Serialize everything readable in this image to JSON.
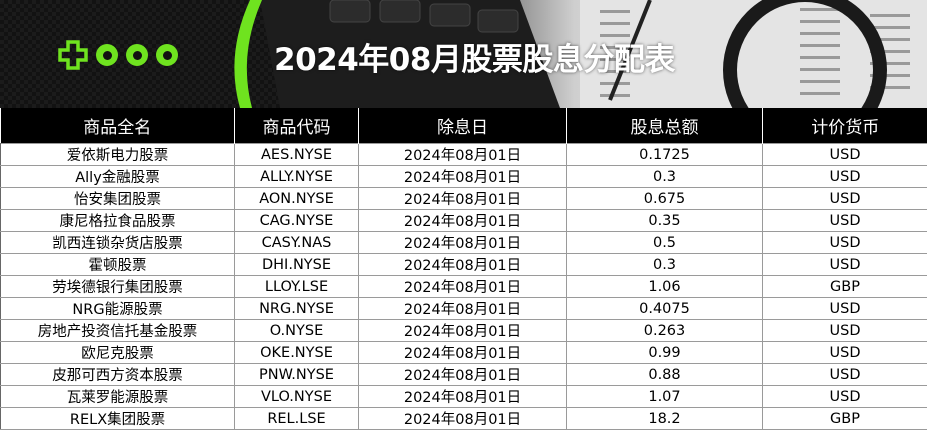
{
  "title": "2024年08月股票股息分配表",
  "brand_color": "#6fe31f",
  "columns": [
    "商品全名",
    "商品代码",
    "除息日",
    "股息总额",
    "计价货币"
  ],
  "rows": [
    [
      "爱依斯电力股票",
      "AES.NYSE",
      "2024年08月01日",
      "0.1725",
      "USD"
    ],
    [
      "Ally金融股票",
      "ALLY.NYSE",
      "2024年08月01日",
      "0.3",
      "USD"
    ],
    [
      "怡安集团股票",
      "AON.NYSE",
      "2024年08月01日",
      "0.675",
      "USD"
    ],
    [
      "康尼格拉食品股票",
      "CAG.NYSE",
      "2024年08月01日",
      "0.35",
      "USD"
    ],
    [
      "凯西连锁杂货店股票",
      "CASY.NAS",
      "2024年08月01日",
      "0.5",
      "USD"
    ],
    [
      "霍顿股票",
      "DHI.NYSE",
      "2024年08月01日",
      "0.3",
      "USD"
    ],
    [
      "劳埃德银行集团股票",
      "LLOY.LSE",
      "2024年08月01日",
      "1.06",
      "GBP"
    ],
    [
      "NRG能源股票",
      "NRG.NYSE",
      "2024年08月01日",
      "0.4075",
      "USD"
    ],
    [
      "房地产投资信托基金股票",
      "O.NYSE",
      "2024年08月01日",
      "0.263",
      "USD"
    ],
    [
      "欧尼克股票",
      "OKE.NYSE",
      "2024年08月01日",
      "0.99",
      "USD"
    ],
    [
      "皮那可西方资本股票",
      "PNW.NYSE",
      "2024年08月01日",
      "0.88",
      "USD"
    ],
    [
      "瓦莱罗能源股票",
      "VLO.NYSE",
      "2024年08月01日",
      "1.07",
      "USD"
    ],
    [
      "RELX集团股票",
      "REL.LSE",
      "2024年08月01日",
      "18.2",
      "GBP"
    ]
  ]
}
